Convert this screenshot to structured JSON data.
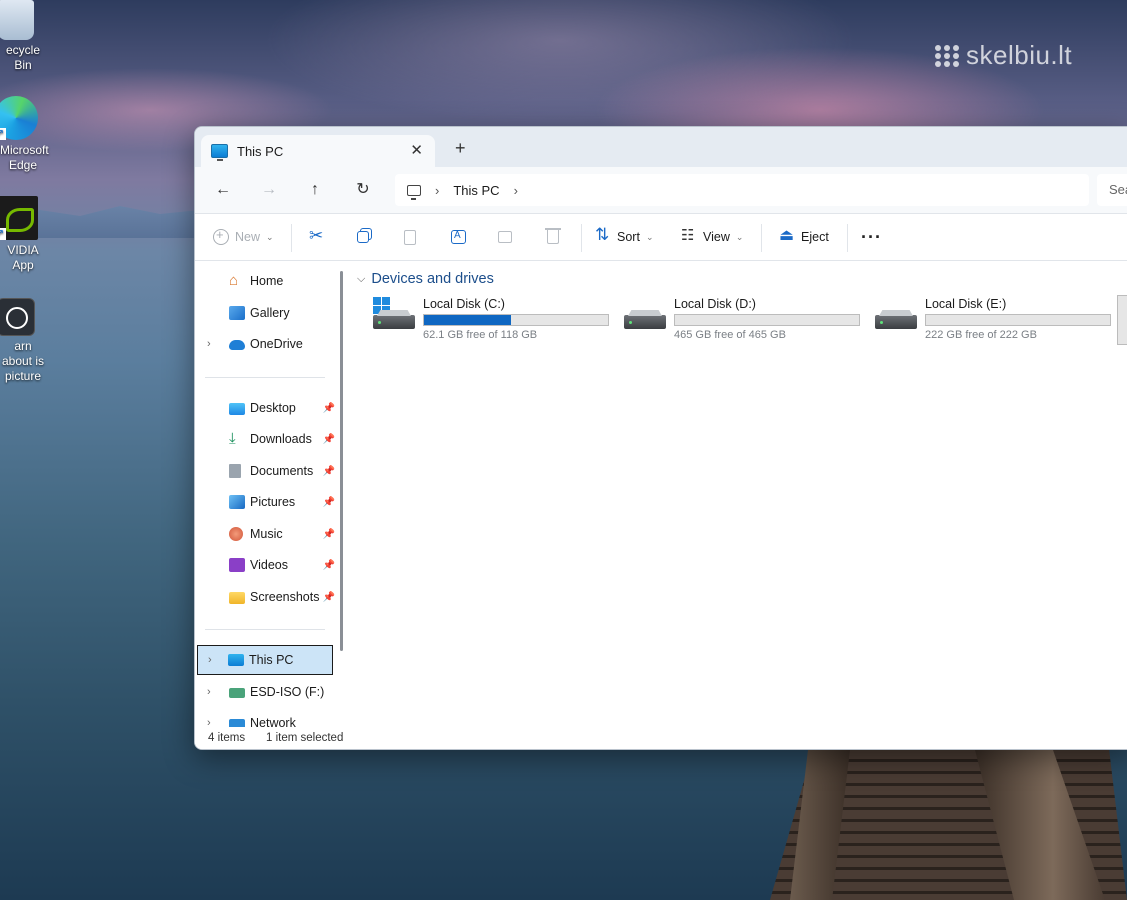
{
  "watermark": {
    "text": "skelbiu.lt"
  },
  "desktop": {
    "icons": [
      {
        "label": "ecycle Bin",
        "icon": "recycle-bin-icon"
      },
      {
        "label": "Microsoft Edge",
        "icon": "edge-icon"
      },
      {
        "label": "VIDIA App",
        "icon": "nvidia-icon"
      },
      {
        "label": "arn about is picture",
        "icon": "learn-about-picture-icon"
      }
    ]
  },
  "window": {
    "tab": {
      "title": "This PC"
    },
    "address": {
      "crumb": "This PC",
      "search_placeholder": "Sea"
    },
    "toolbar": {
      "new_label": "New",
      "sort_label": "Sort",
      "view_label": "View",
      "eject_label": "Eject",
      "more_label": "···"
    },
    "sidebar": {
      "top_items": [
        {
          "label": "Home",
          "icon": "home-icon"
        },
        {
          "label": "Gallery",
          "icon": "gallery-icon"
        },
        {
          "label": "OneDrive",
          "icon": "onedrive-icon"
        }
      ],
      "pinned": [
        {
          "label": "Desktop",
          "icon": "desktop-folder-icon"
        },
        {
          "label": "Downloads",
          "icon": "downloads-icon"
        },
        {
          "label": "Documents",
          "icon": "documents-icon"
        },
        {
          "label": "Pictures",
          "icon": "pictures-icon"
        },
        {
          "label": "Music",
          "icon": "music-icon"
        },
        {
          "label": "Videos",
          "icon": "videos-icon"
        },
        {
          "label": "Screenshots",
          "icon": "folder-icon"
        }
      ],
      "bottom_items": [
        {
          "label": "This PC",
          "icon": "this-pc-icon",
          "selected": true
        },
        {
          "label": "ESD-ISO (F:)",
          "icon": "usb-drive-icon"
        },
        {
          "label": "Network",
          "icon": "network-icon"
        }
      ]
    },
    "content": {
      "group_title": "Devices and drives",
      "drives": [
        {
          "name": "Local Disk (C:)",
          "free_text": "62.1 GB free of 118 GB",
          "used_fraction": 0.474,
          "system": true
        },
        {
          "name": "Local Disk (D:)",
          "free_text": "465 GB free of 465 GB",
          "used_fraction": 0.0,
          "system": false
        },
        {
          "name": "Local Disk (E:)",
          "free_text": "222 GB free of 222 GB",
          "used_fraction": 0.0,
          "system": false
        }
      ]
    },
    "status": {
      "items": "4 items",
      "selected": "1 item selected"
    }
  },
  "colors": {
    "accent": "#0f67c2",
    "selection": "#cce4f7",
    "group_title": "#1c4e8b"
  }
}
